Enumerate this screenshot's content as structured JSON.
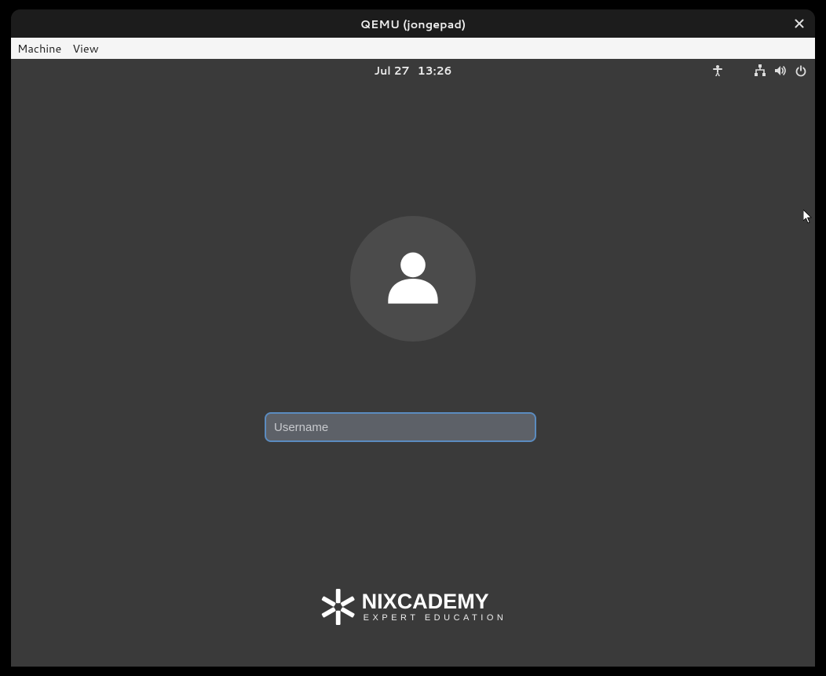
{
  "window": {
    "title": "QEMU (jongepad)"
  },
  "menubar": {
    "items": [
      "Machine",
      "View"
    ]
  },
  "panel": {
    "date": "Jul 27",
    "time": "13:26"
  },
  "login": {
    "username_value": "",
    "username_placeholder": "Username"
  },
  "brand": {
    "name": "NIXCADEMY",
    "tagline": "EXPERT EDUCATION"
  },
  "icons": {
    "close": "close-icon",
    "accessibility": "accessibility-icon",
    "network": "network-wired-icon",
    "volume": "volume-icon",
    "power": "power-icon",
    "avatar": "user-avatar-icon"
  },
  "colors": {
    "guest_bg": "#3a3a3a",
    "accent": "#5b8bbf"
  }
}
